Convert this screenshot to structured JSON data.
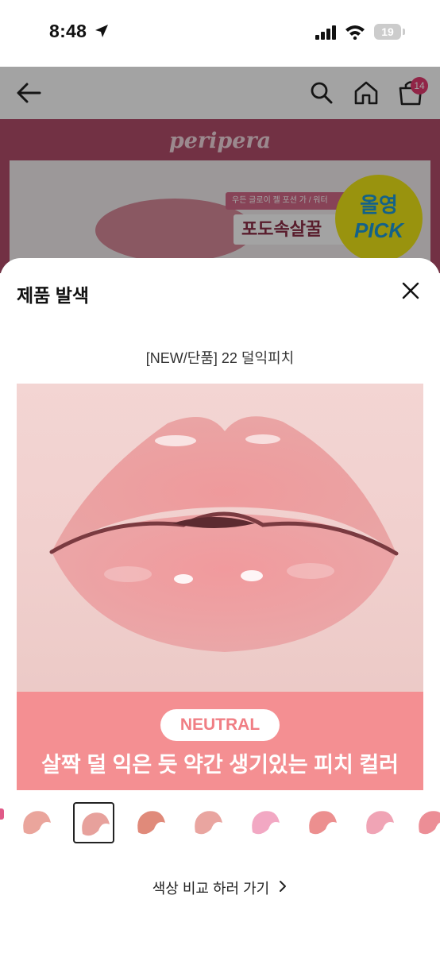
{
  "status_bar": {
    "time": "8:48",
    "battery": "19"
  },
  "background_page": {
    "cart_count": "14",
    "brand": "peripera",
    "promo_tag": "우든 글로이 젤 포션 가 / 워터",
    "promo_title": "포도속살꿀",
    "pick_line1": "올영",
    "pick_line2": "PICK"
  },
  "sheet": {
    "title": "제품 발색",
    "product_name": "[NEW/단품] 22 덜익피치",
    "tone_label": "NEUTRAL",
    "caption": "살짝 덜 익은 듯 약간 생기있는 피치 컬러",
    "swatches": [
      {
        "color": "#eaa59c"
      },
      {
        "color": "#e7a19c",
        "selected": true
      },
      {
        "color": "#e08a7a"
      },
      {
        "color": "#e9a5a0"
      },
      {
        "color": "#f2a8c3"
      },
      {
        "color": "#ec8f8f"
      },
      {
        "color": "#f0a4b5"
      },
      {
        "color": "#ec8e96"
      }
    ],
    "compare_link": "색상 비교 하러 가기"
  },
  "icons": [
    "location-arrow-icon",
    "signal-icon",
    "wifi-icon",
    "back-arrow-icon",
    "search-icon",
    "home-icon",
    "cart-icon",
    "close-icon",
    "chevron-right-icon"
  ]
}
